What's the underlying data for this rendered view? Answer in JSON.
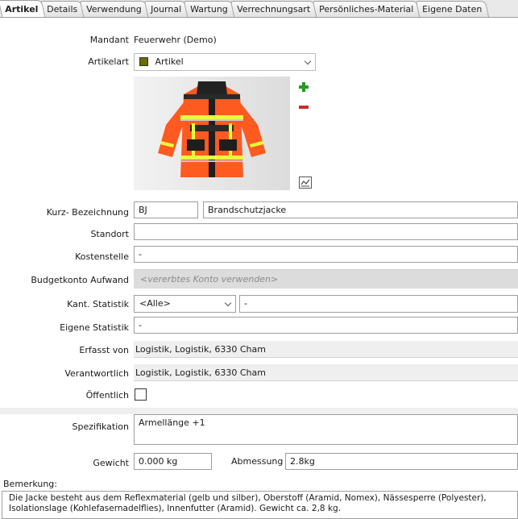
{
  "tabs": [
    {
      "label": "Artikel",
      "active": true
    },
    {
      "label": "Details"
    },
    {
      "label": "Verwendung"
    },
    {
      "label": "Journal"
    },
    {
      "label": "Wartung"
    },
    {
      "label": "Verrechnungsart"
    },
    {
      "label": "Persönliches-Material"
    },
    {
      "label": "Eigene Daten"
    }
  ],
  "form": {
    "mandant": {
      "label": "Mandant",
      "value": "Feuerwehr (Demo)"
    },
    "artikelart": {
      "label": "Artikelart",
      "value": "Artikel",
      "swatch_color": "#6b6b00"
    },
    "image": {
      "add_icon": "plus-icon",
      "remove_icon": "minus-icon",
      "edit_icon": "image-edit-icon"
    },
    "kurz": {
      "label": "Kurz- Bezeichnung",
      "code": "BJ",
      "name": "Brandschutzjacke"
    },
    "standort": {
      "label": "Standort",
      "value": ""
    },
    "kostenstelle": {
      "label": "Kostenstelle",
      "value": "-"
    },
    "budgetkonto": {
      "label": "Budgetkonto Aufwand",
      "placeholder": "<vererbtes Konto verwenden>"
    },
    "kant_statistik": {
      "label": "Kant. Statistik",
      "select_value": "<Alle>",
      "value": "-"
    },
    "eigene_statistik": {
      "label": "Eigene Statistik",
      "value": "-"
    },
    "erfasst_von": {
      "label": "Erfasst von",
      "value": "Logistik, Logistik, 6330 Cham"
    },
    "verantwortlich": {
      "label": "Verantwortlich",
      "value": "Logistik, Logistik, 6330 Cham"
    },
    "oeffentlich": {
      "label": "Öffentlich",
      "checked": false
    },
    "spezifikation": {
      "label": "Spezifikation",
      "value": "Armellänge +1"
    },
    "gewicht": {
      "label": "Gewicht",
      "value": "0.000 kg"
    },
    "abmessung": {
      "label": "Abmessung",
      "value": "2.8kg"
    },
    "bemerkung": {
      "label": "Bemerkung:",
      "line1": "Die Jacke besteht aus dem Reflexmaterial (gelb und silber), Oberstoff (Aramid, Nomex), Nässesperre (Polyester),",
      "line2": "Isolationslage (Kohlefasernadelflies), Innenfutter (Aramid). Gewicht ca. 2,8 kg."
    }
  },
  "colors": {
    "add_green": "#1f9e1f",
    "remove_red": "#cc2a2a",
    "jacket_orange": "#ff5a1f",
    "reflex_yellow": "#e8ff3c"
  }
}
